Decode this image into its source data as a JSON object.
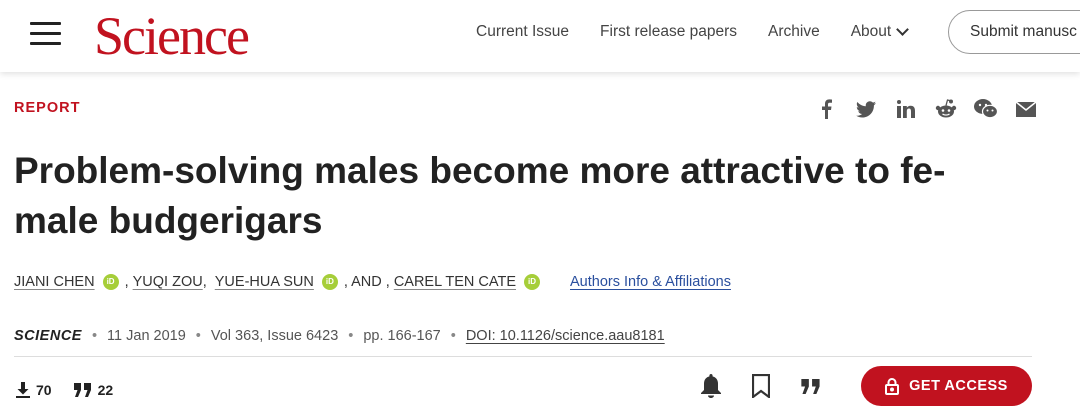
{
  "header": {
    "logo": "Science",
    "nav": [
      "Current Issue",
      "First release papers",
      "Archive",
      "About"
    ],
    "submit_label": "Submit manusc"
  },
  "article": {
    "type": "REPORT",
    "title": "Problem-solving males become more attractive to fe-male budgerigars",
    "authors": [
      "JIANI CHEN",
      "YUQI ZOU",
      "YUE-HUA SUN",
      "CAREL TEN CATE"
    ],
    "authors_and": ", AND ,",
    "affiliations_link": "Authors Info & Affiliations",
    "journal": "SCIENCE",
    "date": "11 Jan 2019",
    "volume": "Vol 363, Issue 6423",
    "pages": "pp. 166-167",
    "doi": "DOI: 10.1126/science.aau8181"
  },
  "share_icons": [
    "facebook-icon",
    "twitter-icon",
    "linkedin-icon",
    "reddit-icon",
    "wechat-icon",
    "email-icon"
  ],
  "stats": {
    "downloads": "70",
    "citations": "22"
  },
  "tools": [
    "bell-icon",
    "bookmark-icon",
    "quote-icon"
  ],
  "access_label": "GET ACCESS",
  "colors": {
    "brand": "#c1121f",
    "orcid": "#a6ce39",
    "link": "#2a4f9e"
  }
}
